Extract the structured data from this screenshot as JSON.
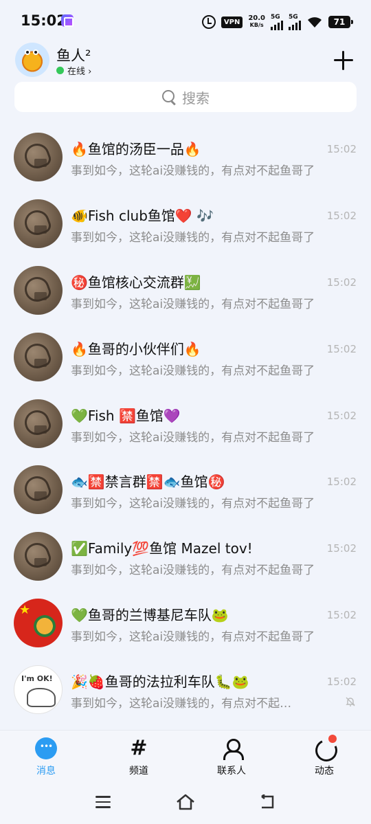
{
  "status_bar": {
    "time": "15:02",
    "vpn": "VPN",
    "net_speed_value": "20.0",
    "net_speed_unit": "KB/s",
    "sim1": "5G",
    "sim2": "5G",
    "battery": "71"
  },
  "header": {
    "name": "鱼人²",
    "status": "在线 ›",
    "online_color": "#35c85a"
  },
  "search": {
    "placeholder": "搜索"
  },
  "chats": [
    {
      "title": "🔥鱼馆的汤臣一品🔥",
      "time": "15:02",
      "preview": "事到如今，这轮ai没赚钱的，有点对不起鱼哥了",
      "avatar": "wood-carving"
    },
    {
      "title": "🐠Fish  club鱼馆❤️ 🎶",
      "time": "15:02",
      "preview": "事到如今，这轮ai没赚钱的，有点对不起鱼哥了",
      "avatar": "wood-carving"
    },
    {
      "title": "㊙️鱼馆核心交流群💹",
      "time": "15:02",
      "preview": "事到如今，这轮ai没赚钱的，有点对不起鱼哥了",
      "avatar": "wood-carving"
    },
    {
      "title": "🔥鱼哥的小伙伴们🔥",
      "time": "15:02",
      "preview": "事到如今，这轮ai没赚钱的，有点对不起鱼哥了",
      "avatar": "wood-carving"
    },
    {
      "title": "💚Fish  🈲鱼馆💜",
      "time": "15:02",
      "preview": "事到如今，这轮ai没赚钱的，有点对不起鱼哥了",
      "avatar": "wood-carving"
    },
    {
      "title": "🐟🈲禁言群🈲🐟鱼馆㊙️",
      "time": "15:02",
      "preview": "事到如今，这轮ai没赚钱的，有点对不起鱼哥了",
      "avatar": "wood-carving"
    },
    {
      "title": "✅Family💯鱼馆 Mazel tov!",
      "time": "15:02",
      "preview": "事到如今，这轮ai没赚钱的，有点对不起鱼哥了",
      "avatar": "wood-carving"
    },
    {
      "title": "💚鱼哥的兰博基尼车队🐸",
      "time": "15:02",
      "preview": "事到如今，这轮ai没赚钱的，有点对不起鱼哥了",
      "avatar": "flag-fish"
    },
    {
      "title": "🎉🍓鱼哥的法拉利车队🐛🐸",
      "time": "15:02",
      "preview": "事到如今，这轮ai没赚钱的，有点对不起…",
      "avatar": "im-ok-sketch",
      "muted": true
    }
  ],
  "bottom_nav": [
    {
      "label": "消息",
      "icon": "message-icon",
      "active": true
    },
    {
      "label": "频道",
      "icon": "hash-icon",
      "active": false
    },
    {
      "label": "联系人",
      "icon": "person-icon",
      "active": false
    },
    {
      "label": "动态",
      "icon": "updates-icon",
      "active": false,
      "badge_dot": true
    }
  ],
  "colors": {
    "accent": "#2b9cf2",
    "background": "#f1f4fb",
    "badge": "#f24a3a"
  }
}
